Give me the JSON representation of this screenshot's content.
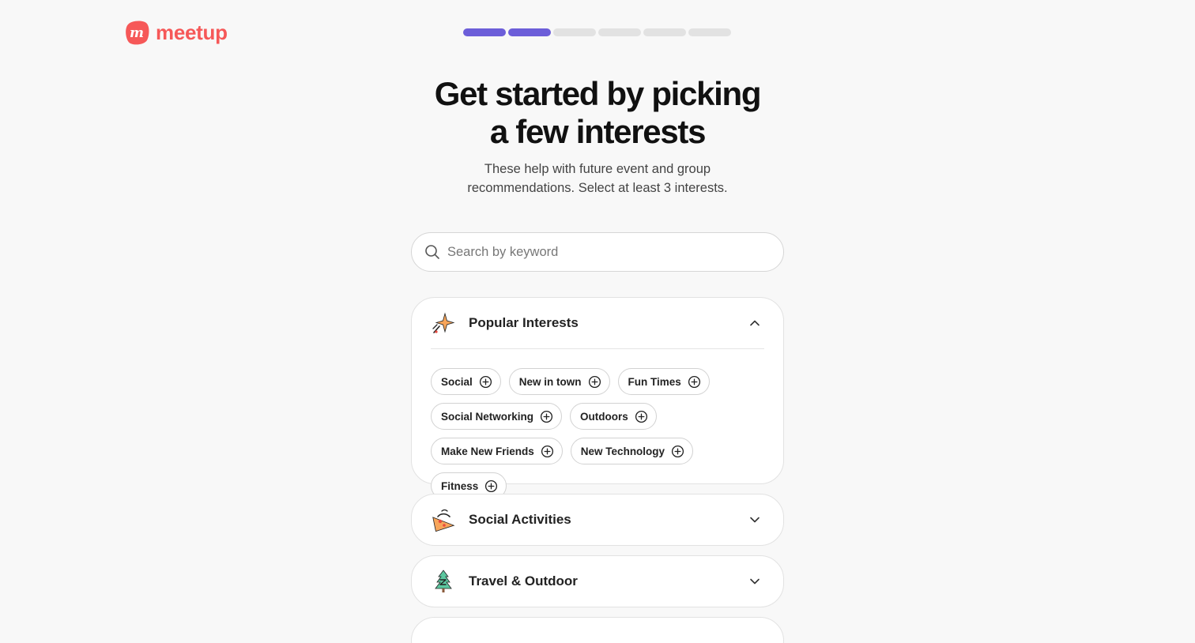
{
  "brand": {
    "name": "meetup",
    "color": "#f65858"
  },
  "progress": {
    "total_steps": 6,
    "completed_steps": 2,
    "accent": "#6c5ed9"
  },
  "heading": {
    "line1": "Get started by picking",
    "line2": "a few interests"
  },
  "subtitle": {
    "line1": "These help with future event and group",
    "line2": "recommendations. Select at least 3 interests."
  },
  "search": {
    "placeholder": "Search by keyword",
    "icon": "search-icon"
  },
  "categories": [
    {
      "title": "Popular Interests",
      "icon": "sparkle-icon",
      "expanded": true,
      "chips": [
        "Social",
        "New in town",
        "Fun Times",
        "Social Networking",
        "Outdoors",
        "Make New Friends",
        "New Technology",
        "Fitness"
      ]
    },
    {
      "title": "Social Activities",
      "icon": "pizza-slice-icon",
      "expanded": false
    },
    {
      "title": "Travel & Outdoor",
      "icon": "pine-tree-icon",
      "expanded": false
    }
  ]
}
